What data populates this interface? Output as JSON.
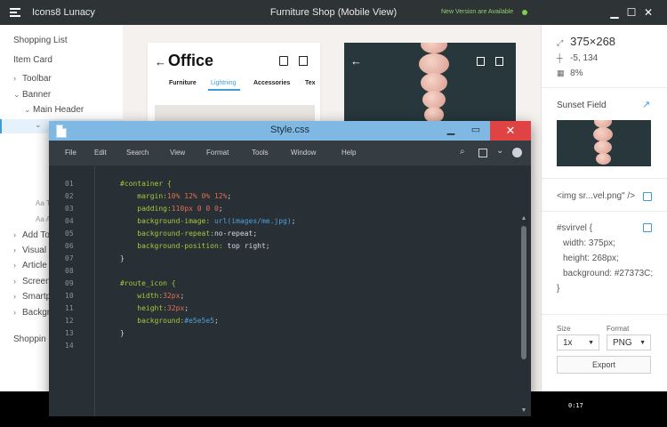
{
  "app": {
    "name": "Icons8 Lunacy",
    "document_title": "Furniture Shop (Mobile View)",
    "update_notice": "New Version are Available",
    "controls": {
      "minimize": "▁",
      "maximize": "☐",
      "close": "✕"
    }
  },
  "layers": {
    "items": [
      {
        "label": "Shopping List",
        "caret": ""
      },
      {
        "label": "Item Card",
        "caret": ""
      },
      {
        "label": "Toolbar",
        "caret": "›"
      },
      {
        "label": "Banner",
        "caret": "⌄"
      },
      {
        "label": "Main Header",
        "caret": "⌄"
      },
      {
        "label": "",
        "caret": "⌄"
      },
      {
        "label": "Aa T",
        "caret": ""
      },
      {
        "label": "Aa A",
        "caret": ""
      },
      {
        "label": "Add To",
        "caret": "›"
      },
      {
        "label": "Visual",
        "caret": "›"
      },
      {
        "label": "Article",
        "caret": "›"
      },
      {
        "label": "Screen",
        "caret": "›"
      },
      {
        "label": "Smartp",
        "caret": "›"
      },
      {
        "label": "Backgr",
        "caret": "›"
      },
      {
        "label": "Shoppin",
        "caret": ""
      }
    ]
  },
  "canvas": {
    "office": {
      "title": "Office",
      "tabs": [
        "Furniture",
        "Lightning",
        "Accessories",
        "Tex"
      ],
      "active_tab": "Lightning"
    }
  },
  "inspector": {
    "size": "375×268",
    "position": "-5, 134",
    "opacity": "8%",
    "fill_name": "Sunset Field",
    "img_snippet": "<img sr...vel.png\" />",
    "css": {
      "selector": "#svirvel {",
      "width": "width: 375px;",
      "height": "height: 268px;",
      "background": "background: #27373C;",
      "close": "}"
    },
    "size_label": "Size",
    "size_value": "1x",
    "format_label": "Format",
    "format_value": "PNG",
    "export_label": "Export"
  },
  "editor": {
    "title": "Style.css",
    "menu": [
      "File",
      "Edit",
      "Search",
      "View",
      "Format",
      "Tools",
      "Window",
      "Help"
    ],
    "line_numbers": [
      "01",
      "02",
      "03",
      "04",
      "05",
      "06",
      "07",
      "08",
      "09",
      "10",
      "11",
      "12",
      "13",
      "14"
    ],
    "lines": [
      [
        {
          "t": "#container {",
          "c": "c-sel"
        }
      ],
      [
        {
          "t": "    margin:",
          "c": "c-prop"
        },
        {
          "t": "10% 12% 0% 12%",
          "c": "c-num"
        },
        {
          "t": ";",
          "c": "c-txt"
        }
      ],
      [
        {
          "t": "    padding:",
          "c": "c-prop"
        },
        {
          "t": "110px 0 0 0",
          "c": "c-num"
        },
        {
          "t": ";",
          "c": "c-txt"
        }
      ],
      [
        {
          "t": "    background-image: ",
          "c": "c-prop"
        },
        {
          "t": "url(images/me.jpg)",
          "c": "c-str"
        },
        {
          "t": ";",
          "c": "c-txt"
        }
      ],
      [
        {
          "t": "    background-repeat:",
          "c": "c-prop"
        },
        {
          "t": "no-repeat;",
          "c": "c-txt"
        }
      ],
      [
        {
          "t": "    background-position: ",
          "c": "c-prop"
        },
        {
          "t": "top right;",
          "c": "c-txt"
        }
      ],
      [
        {
          "t": "}",
          "c": "c-txt"
        }
      ],
      [],
      [
        {
          "t": "#route_icon {",
          "c": "c-sel"
        }
      ],
      [
        {
          "t": "    width:",
          "c": "c-prop"
        },
        {
          "t": "32px",
          "c": "c-num"
        },
        {
          "t": ";",
          "c": "c-txt"
        }
      ],
      [
        {
          "t": "    height:",
          "c": "c-prop"
        },
        {
          "t": "32px",
          "c": "c-num"
        },
        {
          "t": ";",
          "c": "c-txt"
        }
      ],
      [
        {
          "t": "    background:",
          "c": "c-prop"
        },
        {
          "t": "#e5e5e5",
          "c": "c-str"
        },
        {
          "t": ";",
          "c": "c-txt"
        }
      ],
      [
        {
          "t": "}",
          "c": "c-txt"
        }
      ],
      []
    ]
  },
  "timer": "0:17",
  "colors": {
    "titlebar": "#2e3336",
    "accent": "#3b9ddc",
    "editor_bg": "#282f35",
    "editor_titlebar": "#7fb9e3",
    "close_red": "#e04343",
    "photo_bg": "#27373c"
  }
}
